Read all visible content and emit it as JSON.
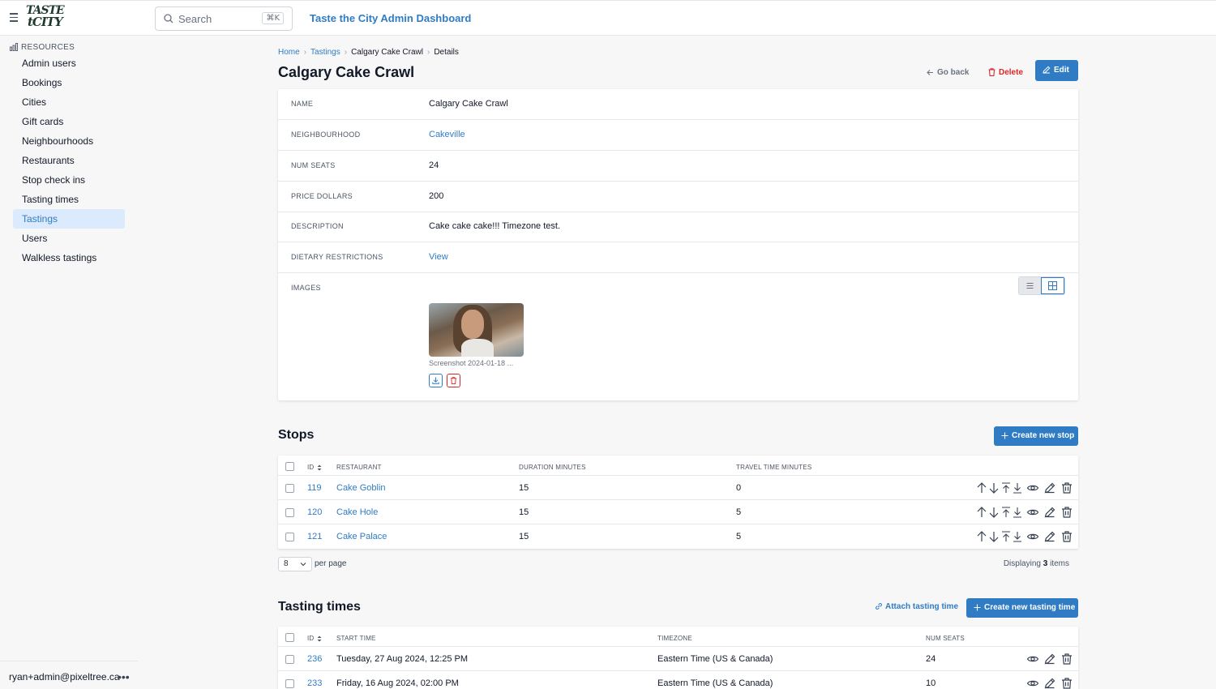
{
  "header": {
    "logo_text": "TASTE the CITY",
    "search": {
      "placeholder": "Search",
      "shortcut": "⌘K"
    },
    "app_title": "Taste the City Admin Dashboard"
  },
  "sidebar": {
    "section_title": "RESOURCES",
    "items": [
      {
        "label": "Admin users"
      },
      {
        "label": "Bookings"
      },
      {
        "label": "Cities"
      },
      {
        "label": "Gift cards"
      },
      {
        "label": "Neighbourhoods"
      },
      {
        "label": "Restaurants"
      },
      {
        "label": "Stop check ins"
      },
      {
        "label": "Tasting times"
      },
      {
        "label": "Tastings",
        "active": true
      },
      {
        "label": "Users"
      },
      {
        "label": "Walkless tastings"
      }
    ],
    "user_email": "ryan+admin@pixeltree.ca",
    "more_glyph": "•••"
  },
  "breadcrumb": [
    "Home",
    "Tastings",
    "Calgary Cake Crawl",
    "Details"
  ],
  "page": {
    "title": "Calgary Cake Crawl",
    "go_back_label": "Go back",
    "delete_label": "Delete",
    "edit_label": "Edit"
  },
  "details": {
    "fields": [
      {
        "label": "NAME",
        "value": "Calgary Cake Crawl"
      },
      {
        "label": "NEIGHBOURHOOD",
        "value": "Cakeville"
      },
      {
        "label": "NUM SEATS",
        "value": "24"
      },
      {
        "label": "PRICE DOLLARS",
        "value": "200"
      },
      {
        "label": "DESCRIPTION",
        "value": "Cake cake cake!!! Timezone test."
      },
      {
        "label": "DIETARY RESTRICTIONS",
        "value": "View"
      }
    ],
    "images_label": "IMAGES",
    "image_caption": "Screenshot 2024-01-18 ..."
  },
  "stops": {
    "title": "Stops",
    "create_label": "Create new stop",
    "columns": [
      "ID",
      "RESTAURANT",
      "DURATION MINUTES",
      "TRAVEL TIME MINUTES"
    ],
    "rows": [
      {
        "id": "119",
        "restaurant": "Cake Goblin",
        "duration": "15",
        "travel": "0"
      },
      {
        "id": "120",
        "restaurant": "Cake Hole",
        "duration": "15",
        "travel": "5"
      },
      {
        "id": "121",
        "restaurant": "Cake Palace",
        "duration": "15",
        "travel": "5"
      }
    ],
    "per_page_value": "8",
    "per_page_label": "per page",
    "displaying_prefix": "Displaying",
    "displaying_count": "3",
    "displaying_suffix": "items"
  },
  "tasting_times": {
    "title": "Tasting times",
    "attach_label": "Attach tasting time",
    "create_label": "Create new tasting time",
    "columns": [
      "ID",
      "START TIME",
      "TIMEZONE",
      "NUM SEATS"
    ],
    "rows": [
      {
        "id": "236",
        "start": "Tuesday, 27 Aug 2024, 12:25 PM",
        "timezone": "Eastern Time (US & Canada)",
        "seats": "24"
      },
      {
        "id": "233",
        "start": "Friday, 16 Aug 2024, 02:00 PM",
        "timezone": "Eastern Time (US & Canada)",
        "seats": "10"
      }
    ]
  },
  "colors": {
    "accent": "#2f7cc4",
    "danger": "#dc2626",
    "active_bg": "#dbeafc"
  }
}
